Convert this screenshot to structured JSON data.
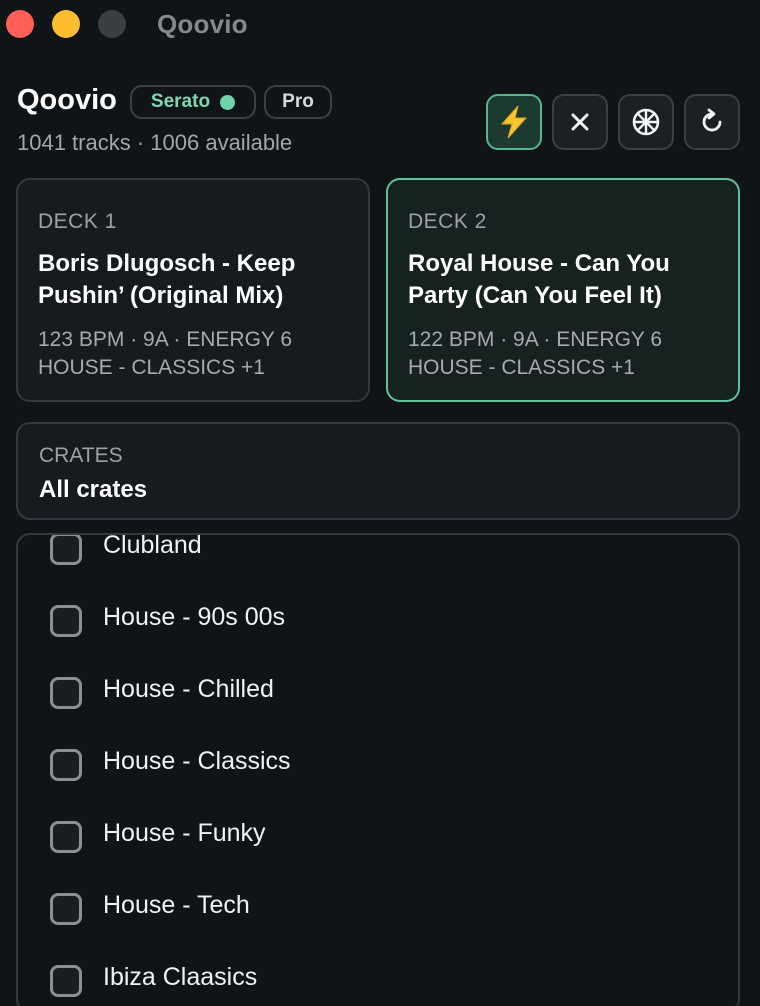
{
  "window": {
    "title": "Qoovio"
  },
  "header": {
    "app_name": "Qoovio",
    "source_badge": "Serato",
    "plan_badge": "Pro",
    "stats": "1041 tracks · 1006 available",
    "toolbar": {
      "auto_icon": "lightning-icon",
      "close_icon": "close-icon",
      "wheel_icon": "wheel-icon",
      "refresh_icon": "refresh-icon"
    }
  },
  "decks": [
    {
      "label": "DECK 1",
      "title": "Boris Dlugosch - Keep Pushin’ (Original Mix)",
      "meta": "123 BPM · 9A · ENERGY 6",
      "crates": "HOUSE - CLASSICS +1",
      "active": false
    },
    {
      "label": "DECK 2",
      "title": "Royal House - Can You Party (Can You Feel It)",
      "meta": "122 BPM · 9A · ENERGY 6",
      "crates": "HOUSE - CLASSICS +1",
      "active": true
    }
  ],
  "crates": {
    "label": "CRATES",
    "selected": "All crates",
    "items": [
      {
        "name": "Clubland",
        "checked": false
      },
      {
        "name": "House - 90s 00s",
        "checked": false
      },
      {
        "name": "House - Chilled",
        "checked": false
      },
      {
        "name": "House - Classics",
        "checked": false
      },
      {
        "name": "House - Funky",
        "checked": false
      },
      {
        "name": "House - Tech",
        "checked": false
      },
      {
        "name": "Ibiza Claasics",
        "checked": false
      }
    ]
  },
  "colors": {
    "accent": "#5fc09a",
    "status_dot": "#6fd4a8",
    "background": "#111417"
  }
}
